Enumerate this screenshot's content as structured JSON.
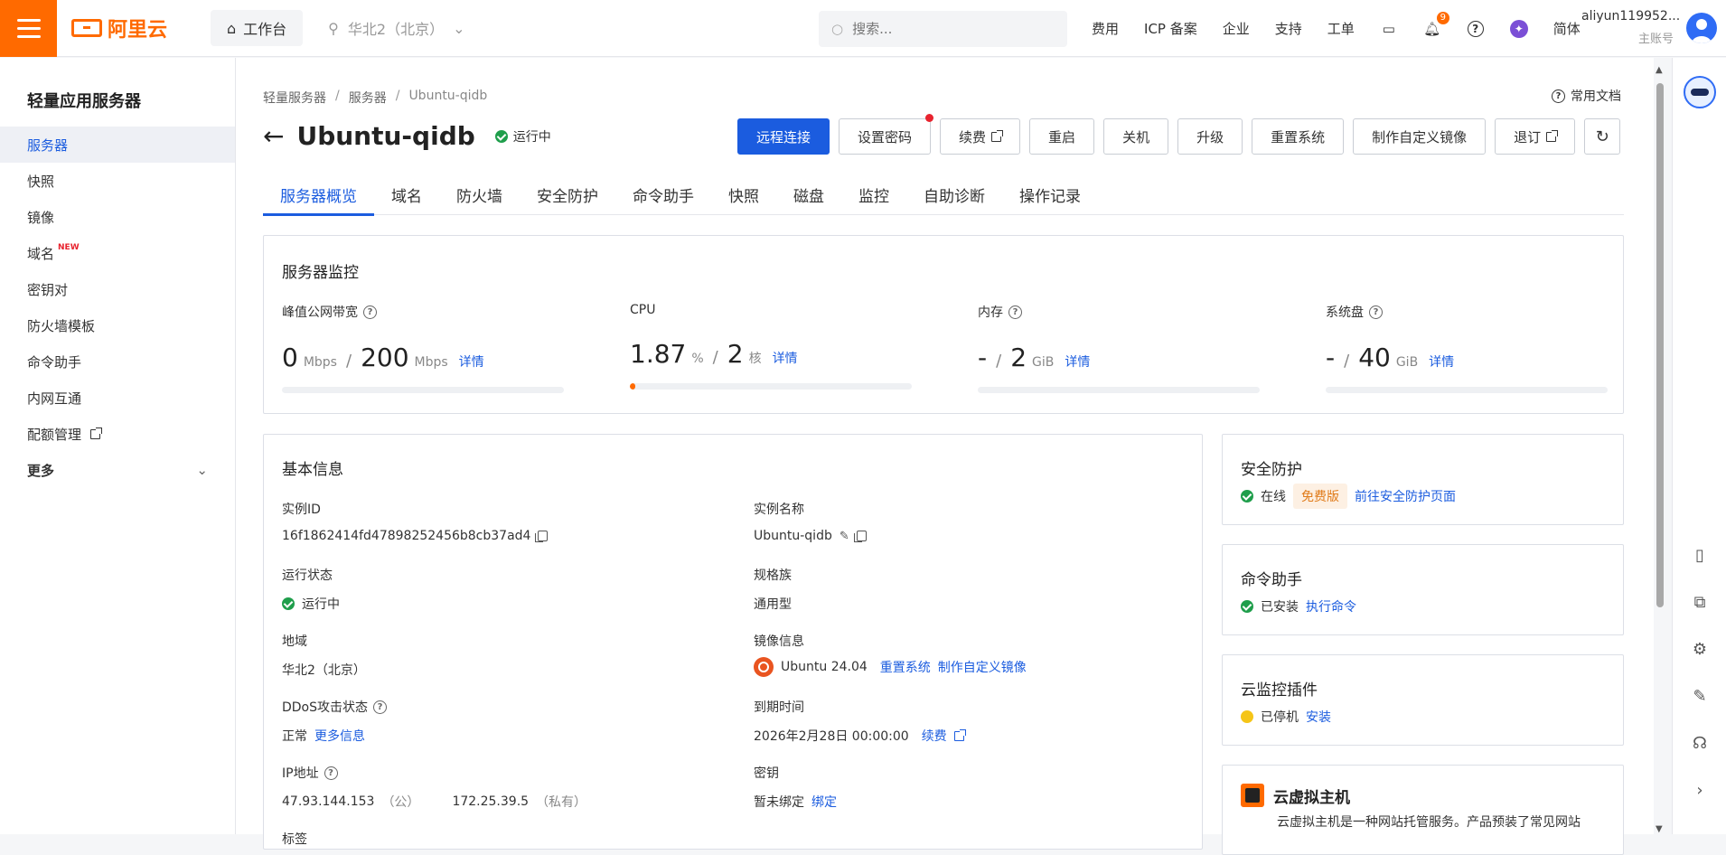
{
  "topbar": {
    "logo_text": "阿里云",
    "workbench": "工作台",
    "region": "华北2（北京）",
    "search_placeholder": "搜索...",
    "links": [
      "费用",
      "ICP 备案",
      "企业",
      "支持",
      "工单"
    ],
    "notification_count": "9",
    "lang": "简体",
    "username": "aliyun119952...",
    "role": "主账号"
  },
  "sidebar": {
    "title": "轻量应用服务器",
    "items": [
      {
        "label": "服务器"
      },
      {
        "label": "快照"
      },
      {
        "label": "镜像"
      },
      {
        "label": "域名",
        "badge": "NEW"
      },
      {
        "label": "密钥对"
      },
      {
        "label": "防火墙模板"
      },
      {
        "label": "命令助手"
      },
      {
        "label": "内网互通"
      },
      {
        "label": "配额管理"
      }
    ],
    "more": "更多"
  },
  "breadcrumb": [
    "轻量服务器",
    "服务器",
    "Ubuntu-qidb"
  ],
  "help_link": "常用文档",
  "server": {
    "name": "Ubuntu-qidb",
    "status": "运行中"
  },
  "actions": {
    "remote": "远程连接",
    "password": "设置密码",
    "renew": "续费",
    "restart": "重启",
    "shutdown": "关机",
    "upgrade": "升级",
    "reset": "重置系统",
    "custom_image": "制作自定义镜像",
    "refund": "退订"
  },
  "tabs": [
    "服务器概览",
    "域名",
    "防火墙",
    "安全防护",
    "命令助手",
    "快照",
    "磁盘",
    "监控",
    "自助诊断",
    "操作记录"
  ],
  "monitor": {
    "title": "服务器监控",
    "detail": "详情",
    "bandwidth": {
      "label": "峰值公网带宽",
      "used": "0",
      "used_unit": "Mbps",
      "total": "200",
      "total_unit": "Mbps",
      "percent": 0
    },
    "cpu": {
      "label": "CPU",
      "used": "1.87",
      "used_unit": "%",
      "total": "2",
      "total_unit": "核",
      "percent": 1.87
    },
    "memory": {
      "label": "内存",
      "used": "-",
      "total": "2",
      "total_unit": "GiB",
      "percent": 0
    },
    "disk": {
      "label": "系统盘",
      "used": "-",
      "total": "40",
      "total_unit": "GiB",
      "percent": 0
    }
  },
  "basic": {
    "title": "基本信息",
    "instance_id_label": "实例ID",
    "instance_id": "16f1862414fd47898252456b8cb37ad4",
    "instance_name_label": "实例名称",
    "instance_name": "Ubuntu-qidb",
    "run_status_label": "运行状态",
    "run_status": "运行中",
    "spec_label": "规格族",
    "spec": "通用型",
    "region_label": "地域",
    "region": "华北2（北京）",
    "image_label": "镜像信息",
    "image": "Ubuntu 24.04",
    "image_reset": "重置系统",
    "image_custom": "制作自定义镜像",
    "ddos_label": "DDoS攻击状态",
    "ddos": "正常",
    "ddos_more": "更多信息",
    "expire_label": "到期时间",
    "expire": "2026年2月28日 00:00:00",
    "expire_renew": "续费",
    "ip_label": "IP地址",
    "public_ip": "47.93.144.153",
    "public_tag": "（公）",
    "private_ip": "172.25.39.5",
    "private_tag": "（私有）",
    "key_label": "密钥",
    "key": "暂未绑定",
    "key_bind": "绑定",
    "tags_label": "标签"
  },
  "security": {
    "title": "安全防护",
    "status": "在线",
    "edition": "免费版",
    "link": "前往安全防护页面"
  },
  "command": {
    "title": "命令助手",
    "status": "已安装",
    "link": "执行命令"
  },
  "cloudmonitor": {
    "title": "云监控插件",
    "status": "已停机",
    "link": "安装"
  },
  "vhost": {
    "title": "云虚拟主机",
    "desc": "云虚拟主机是一种网站托管服务。产品预装了常见网站"
  },
  "colors": {
    "brand": "#ff6a00",
    "primary": "#1b5cdf",
    "success": "#1f9e4b",
    "warning": "#f5c518"
  }
}
